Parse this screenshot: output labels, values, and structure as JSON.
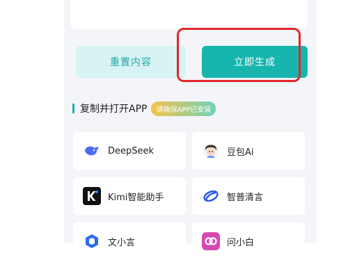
{
  "actions": {
    "reset_label": "重置内容",
    "generate_label": "立即生成"
  },
  "section": {
    "title": "复制并打开APP",
    "badge": "请确保APP已安装"
  },
  "apps": [
    {
      "label": "DeepSeek",
      "icon": "deepseek-whale-icon"
    },
    {
      "label": "豆包Ai",
      "icon": "doubao-avatar-icon"
    },
    {
      "label": "Kimi智能助手",
      "icon": "kimi-k-icon"
    },
    {
      "label": "智普清言",
      "icon": "zhipu-swirl-icon"
    },
    {
      "label": "文小言",
      "icon": "wenxiaoyan-icon"
    },
    {
      "label": "问小白",
      "icon": "wenxiaobai-icon"
    }
  ],
  "colors": {
    "accent": "#17b5ad",
    "reset_bg": "#d8f3f3",
    "highlight": "#e0272a",
    "panel_bg": "#f3f5f9"
  }
}
